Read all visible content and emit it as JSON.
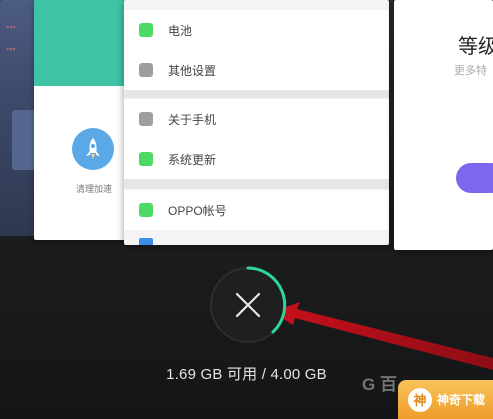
{
  "recent_apps": {
    "security_card": {
      "shortcut_label": "清理加速"
    },
    "settings_card": {
      "items": [
        {
          "label": "电池",
          "icon": "battery-icon",
          "color": "#4cd964"
        },
        {
          "label": "其他设置",
          "icon": "other-settings-icon",
          "color": "#9e9e9e"
        },
        {
          "label": "关于手机",
          "icon": "about-phone-icon",
          "color": "#9e9e9e"
        },
        {
          "label": "系统更新",
          "icon": "system-update-icon",
          "color": "#4cd964"
        },
        {
          "label": "OPPO帐号",
          "icon": "oppo-account-icon",
          "color": "#4cd964"
        }
      ]
    },
    "right_card": {
      "title": "等级",
      "subtitle": "更多特"
    }
  },
  "memory": {
    "available": "1.69 GB 可用",
    "separator": " / ",
    "total": "4.00 GB"
  },
  "close_all": {
    "icon": "close-icon",
    "ring_color": "#2ed69a"
  },
  "watermark": {
    "baidu_text": "G 百",
    "site_text": "神奇下载",
    "logo_char": "神"
  },
  "colors": {
    "teal_header": "#3ec3a5",
    "accent_purple": "#7b68ee",
    "arrow_red": "#b0101a"
  }
}
